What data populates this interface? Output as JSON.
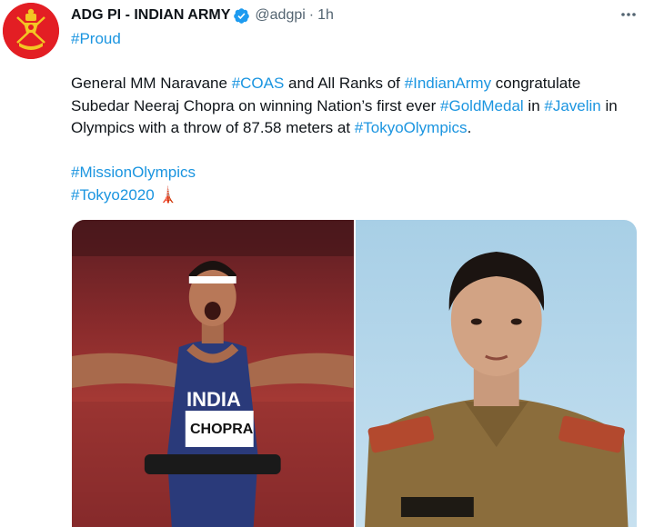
{
  "account": {
    "name": "ADG PI - INDIAN ARMY",
    "handle": "@adgpi",
    "separator": "·",
    "time": "1h"
  },
  "tweet": {
    "line1": [
      {
        "t": "#Proud",
        "tag": true
      }
    ],
    "para": [
      {
        "t": "General MM Naravane ",
        "tag": false
      },
      {
        "t": "#COAS",
        "tag": true
      },
      {
        "t": " and All Ranks of ",
        "tag": false
      },
      {
        "t": "#IndianArmy",
        "tag": true
      },
      {
        "t": " congratulate Subedar Neeraj Chopra on winning Nation’s first ever ",
        "tag": false
      },
      {
        "t": "#GoldMedal",
        "tag": true
      },
      {
        "t": " in ",
        "tag": false
      },
      {
        "t": "#Javelin",
        "tag": true
      },
      {
        "t": " in Olympics with a throw of 87.58 meters at ",
        "tag": false
      },
      {
        "t": "#TokyoOlympics",
        "tag": true
      },
      {
        "t": ".",
        "tag": false
      }
    ],
    "line3": [
      {
        "t": "#MissionOlympics",
        "tag": true
      }
    ],
    "line4": [
      {
        "t": "#Tokyo2020",
        "tag": true
      },
      {
        "t": " 🗼",
        "tag": false
      }
    ]
  },
  "media": {
    "left_bib_country": "INDIA",
    "left_bib_name": "CHOPRA"
  },
  "icons": {
    "verified": "verified-badge-icon",
    "more": "more-options-icon",
    "avatar": "indian-army-emblem"
  },
  "colors": {
    "hashtag": "#1b95e0",
    "avatar_bg": "#e31e24",
    "verified": "#1d9bf0"
  }
}
